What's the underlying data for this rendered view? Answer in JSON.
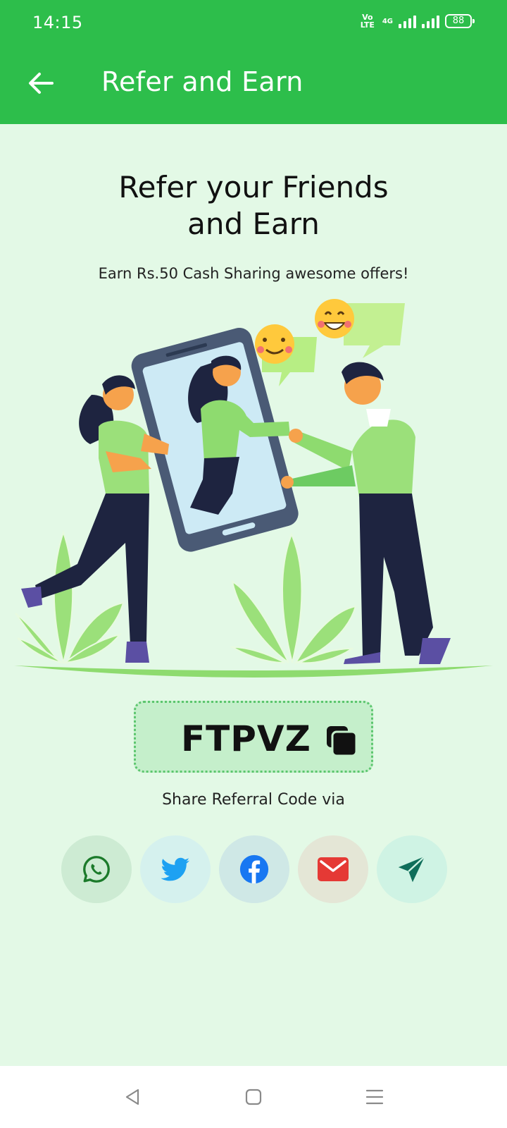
{
  "status_bar": {
    "time": "14:15",
    "volte": "Vo LTE",
    "network": "4G",
    "battery": "88"
  },
  "app_bar": {
    "title": "Refer and Earn"
  },
  "hero": {
    "headline_line1": "Refer your Friends",
    "headline_line2": "and Earn",
    "subtitle": "Earn Rs.50 Cash Sharing awesome offers!"
  },
  "referral": {
    "code": "FTPVZ",
    "share_label": "Share Referral Code via"
  },
  "share_options": [
    {
      "name": "whatsapp-icon",
      "color": "#1B7A2A",
      "bg": "#CDEBD3"
    },
    {
      "name": "twitter-icon",
      "color": "#1DA1F2",
      "bg": "#D5F1EE"
    },
    {
      "name": "facebook-icon",
      "color": "#1877F2",
      "bg": "#CFE8E6"
    },
    {
      "name": "mail-icon",
      "color": "#E53935",
      "bg": "#E4E6D6"
    },
    {
      "name": "send-icon",
      "color": "#0F6E5A",
      "bg": "#CFF3E4"
    }
  ],
  "colors": {
    "primary": "#2DBE4B",
    "background": "#E3F9E6",
    "code_box": "#C5EFCB"
  }
}
